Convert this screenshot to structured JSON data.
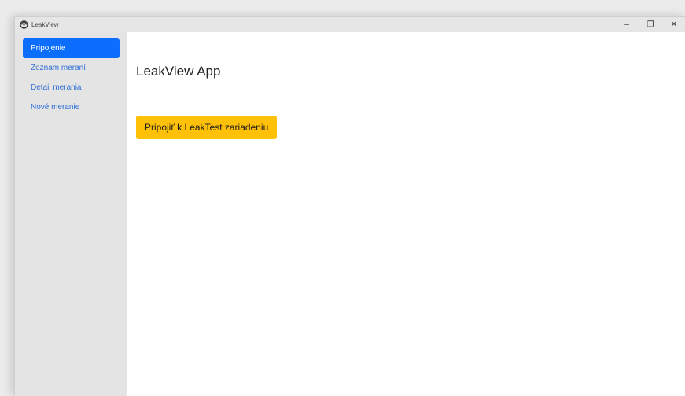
{
  "window": {
    "title": "LeakView",
    "controls": {
      "minimize": "–",
      "restore": "❐",
      "close": "✕"
    }
  },
  "sidebar": {
    "items": [
      {
        "label": "Pripojenie",
        "active": true
      },
      {
        "label": "Zoznam meraní",
        "active": false
      },
      {
        "label": "Detail merania",
        "active": false
      },
      {
        "label": "Nové meranie",
        "active": false
      }
    ]
  },
  "main": {
    "title": "LeakView App",
    "connect_button": "Pripojiť k LeakTest zariadeniu"
  },
  "colors": {
    "active_nav": "#0d6efd",
    "nav_link": "#2f6fd6",
    "connect_button": "#ffc107",
    "sidebar_bg": "#e4e4e4"
  },
  "icons": {
    "app": "app-logo-icon"
  }
}
